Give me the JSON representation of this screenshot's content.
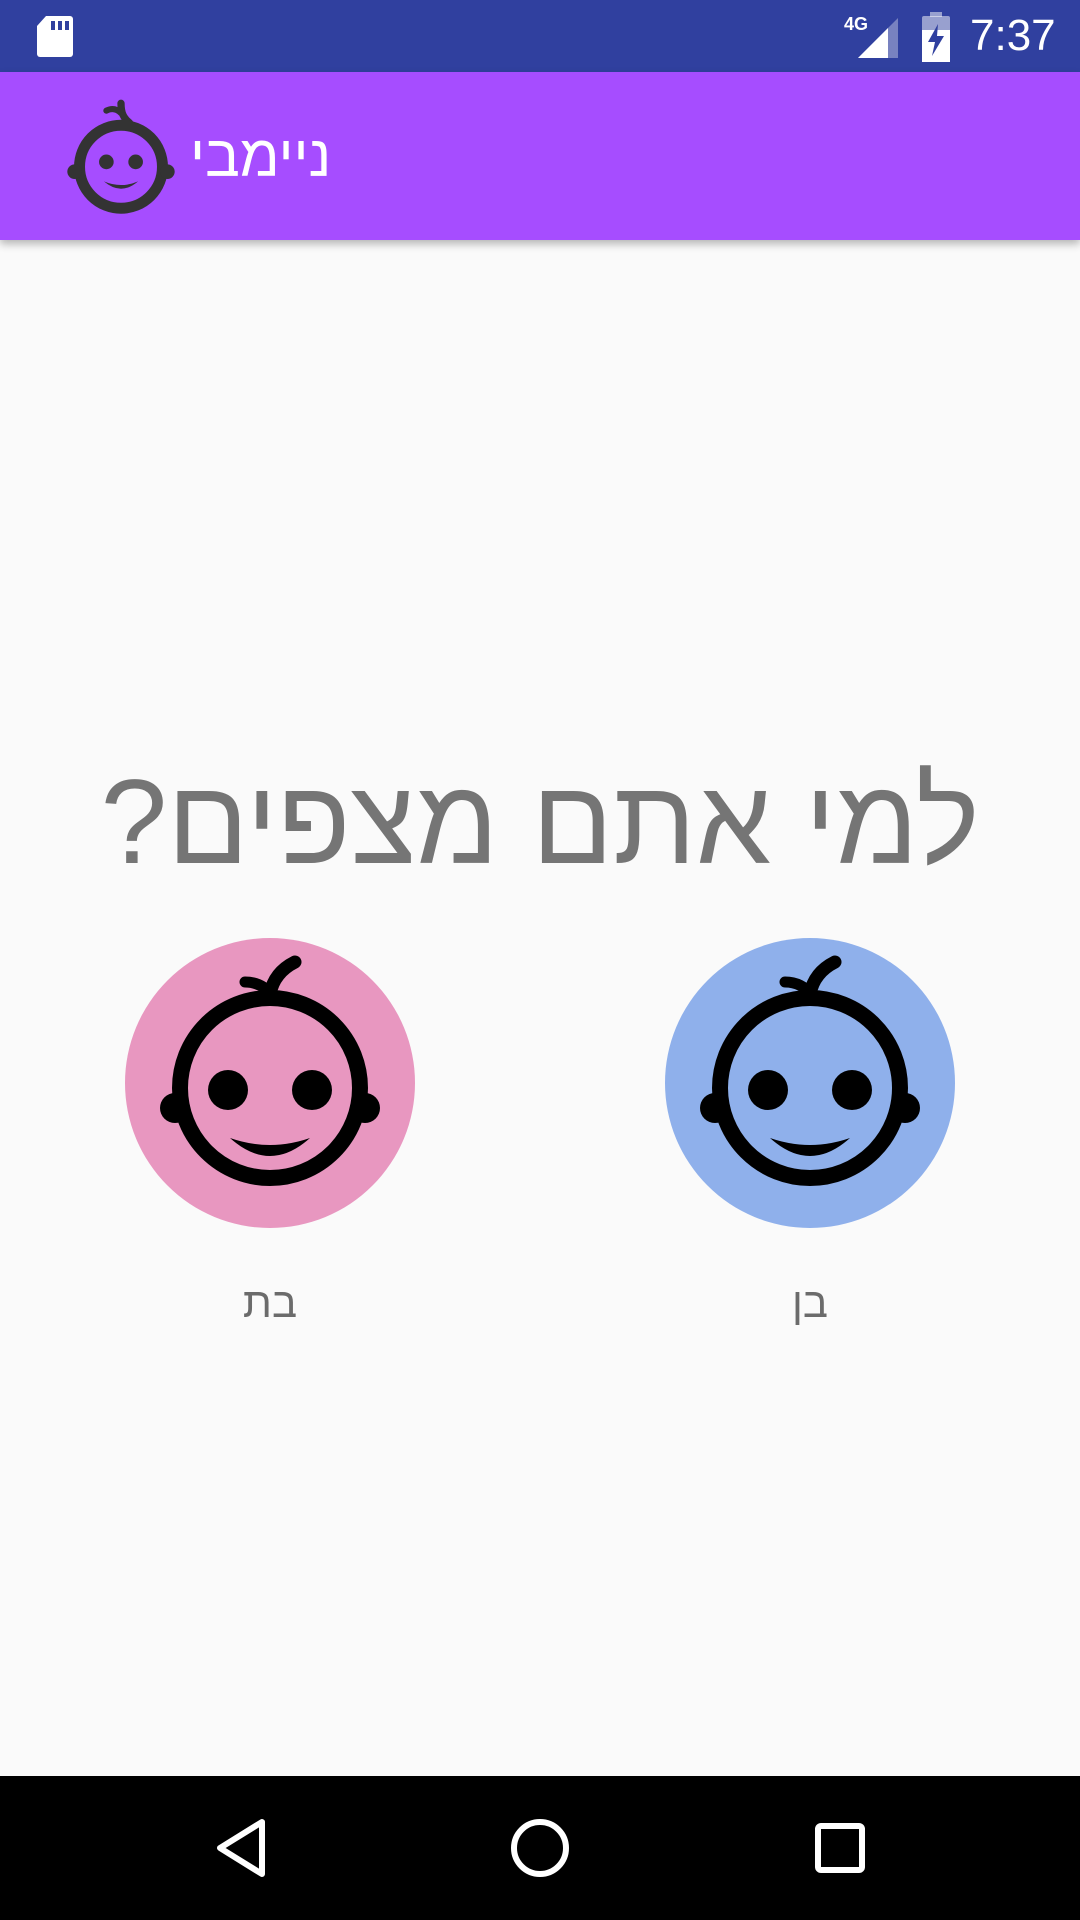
{
  "status_bar": {
    "time": "7:37",
    "network": "4G",
    "icons": [
      "sd-card-icon",
      "signal-icon",
      "battery-charging-icon"
    ]
  },
  "app_bar": {
    "title": "ניימבי",
    "logo_icon": "baby-face-icon",
    "color": "#a64dff"
  },
  "main": {
    "question": "למי אתם מצפים?",
    "choices": [
      {
        "label": "בת",
        "icon": "baby-face-icon",
        "color": "#e897c0"
      },
      {
        "label": "בן",
        "icon": "baby-face-icon",
        "color": "#8fb0eb"
      }
    ]
  },
  "nav_bar": {
    "buttons": [
      "back-icon",
      "home-icon",
      "recents-icon"
    ]
  },
  "colors": {
    "status_bar": "#30409f",
    "background": "#fafafa",
    "question_text": "#757575"
  }
}
